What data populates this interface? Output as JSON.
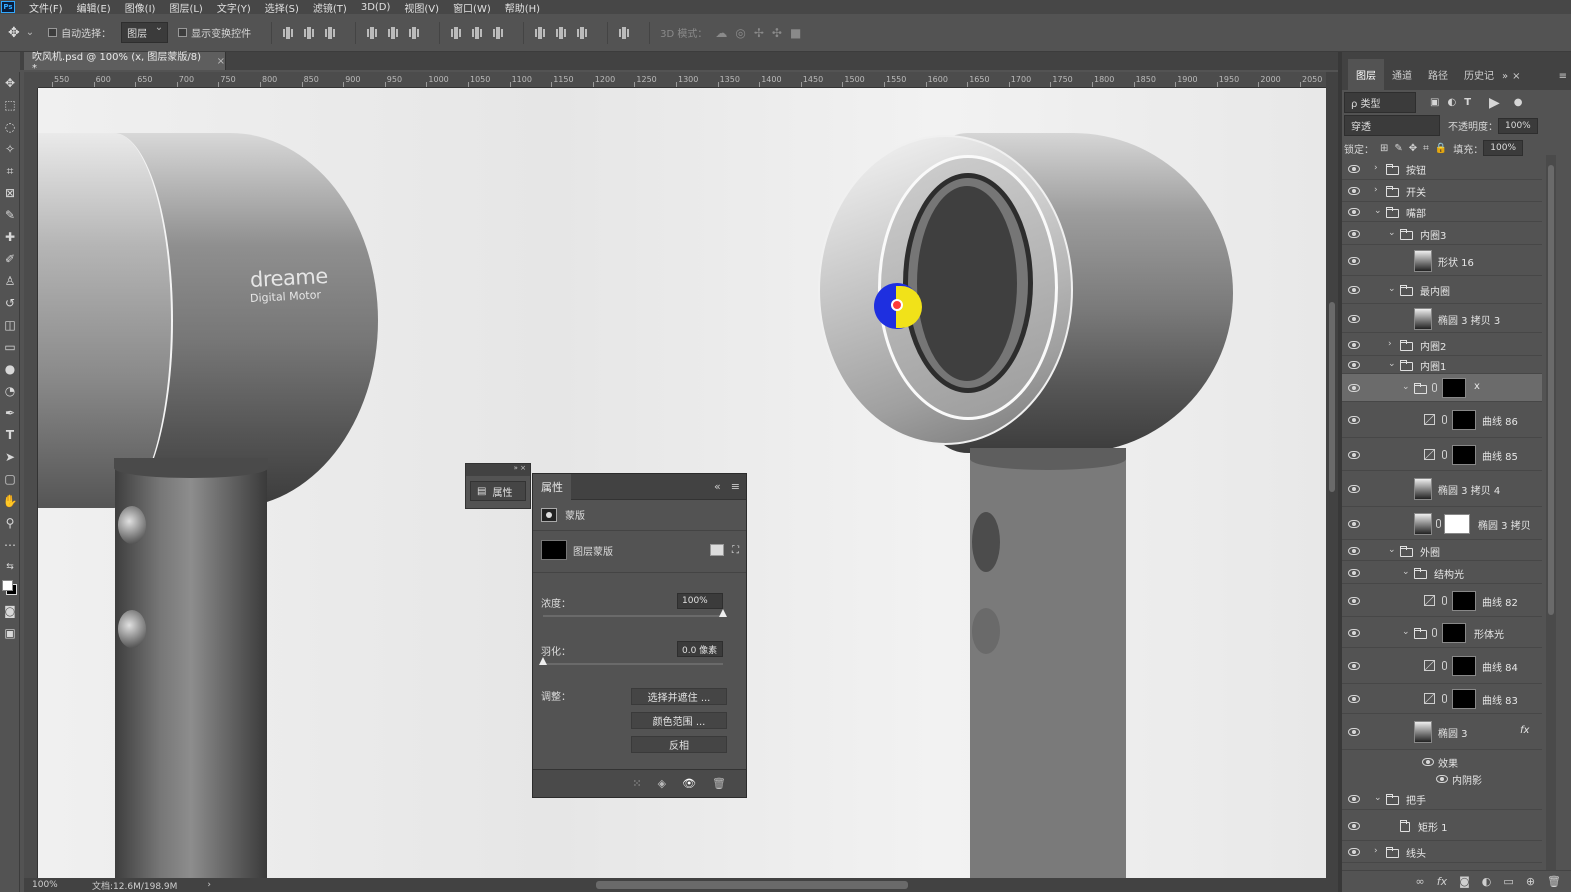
{
  "menu": {
    "app_icon": "Ps",
    "items": [
      "文件(F)",
      "编辑(E)",
      "图像(I)",
      "图层(L)",
      "文字(Y)",
      "选择(S)",
      "滤镜(T)",
      "3D(D)",
      "视图(V)",
      "窗口(W)",
      "帮助(H)"
    ]
  },
  "options": {
    "auto_select_label": "自动选择：",
    "auto_select_value": "图层",
    "show_transform_label": "显示变换控件",
    "mode_3d_label": "3D 模式："
  },
  "document": {
    "tab_title": "吹风机.psd @ 100% (x, 图层蒙版/8) *",
    "zoom": "100%",
    "doc_info": "文档:12.6M/198.9M"
  },
  "ruler": {
    "h_labels": [
      "550",
      "600",
      "650",
      "700",
      "750",
      "800",
      "850",
      "900",
      "950",
      "1000",
      "1050",
      "1100",
      "1150",
      "1200",
      "1250",
      "1300",
      "1350",
      "1400",
      "1450",
      "1500",
      "1550",
      "1600",
      "1650",
      "1700",
      "1750",
      "1800",
      "1850",
      "1900",
      "1950",
      "2000",
      "2050"
    ]
  },
  "canvas": {
    "brand_line1": "dreame",
    "brand_line2": "Digital Motor"
  },
  "mini_panel": {
    "button_label": "属性"
  },
  "properties": {
    "tab_label": "属性",
    "section_label": "蒙版",
    "mask_label": "图层蒙版",
    "density_label": "浓度：",
    "density_value": "100%",
    "density_fraction": 1.0,
    "feather_label": "羽化：",
    "feather_value": "0.0 像素",
    "feather_fraction": 0.0,
    "adjust_label": "调整：",
    "btn_select_mask": "选择并遮住 ...",
    "btn_color_range": "颜色范围 ...",
    "btn_invert": "反相"
  },
  "layers_panel": {
    "tabs": [
      "图层",
      "通道",
      "路径",
      "历史记"
    ],
    "filter_label": "ρ 类型",
    "blend_mode": "穿透",
    "opacity_label": "不透明度：",
    "opacity_value": "100%",
    "lock_label": "锁定：",
    "fill_label": "填充：",
    "fill_value": "100%",
    "layers": [
      {
        "name": "按钮",
        "type": "group",
        "indent": 0,
        "collapsed": true
      },
      {
        "name": "开关",
        "type": "group",
        "indent": 0,
        "collapsed": true
      },
      {
        "name": "嘴部",
        "type": "group",
        "indent": 0,
        "collapsed": false
      },
      {
        "name": "内圈3",
        "type": "group",
        "indent": 1,
        "collapsed": false
      },
      {
        "name": "形状 16",
        "type": "shape",
        "indent": 2
      },
      {
        "name": "最内圈",
        "type": "group",
        "indent": 1,
        "collapsed": false
      },
      {
        "name": "椭圆 3 拷贝 3",
        "type": "shape",
        "indent": 2
      },
      {
        "name": "内圈2",
        "type": "group",
        "indent": 1,
        "collapsed": true
      },
      {
        "name": "内圈1",
        "type": "group",
        "indent": 1,
        "collapsed": false
      },
      {
        "name": "x",
        "type": "masked-group",
        "indent": 2,
        "selected": true
      },
      {
        "name": "曲线 86",
        "type": "adjustment",
        "indent": 3
      },
      {
        "name": "曲线 85",
        "type": "adjustment",
        "indent": 3
      },
      {
        "name": "椭圆 3 拷贝 4",
        "type": "shape",
        "indent": 2
      },
      {
        "name": "椭圆 3 拷贝",
        "type": "shape-mask",
        "indent": 2
      },
      {
        "name": "外圈",
        "type": "group",
        "indent": 1,
        "collapsed": false
      },
      {
        "name": "结构光",
        "type": "group",
        "indent": 2,
        "collapsed": false
      },
      {
        "name": "曲线 82",
        "type": "adjustment",
        "indent": 3
      },
      {
        "name": "形体光",
        "type": "masked-group",
        "indent": 2
      },
      {
        "name": "曲线 84",
        "type": "adjustment",
        "indent": 3
      },
      {
        "name": "曲线 83",
        "type": "adjustment",
        "indent": 3
      },
      {
        "name": "椭圆 3",
        "type": "shape-fx",
        "indent": 2
      },
      {
        "name": "效果",
        "type": "effect",
        "indent": 3
      },
      {
        "name": "内阴影",
        "type": "effect-item",
        "indent": 3
      },
      {
        "name": "把手",
        "type": "group",
        "indent": 0,
        "collapsed": false
      },
      {
        "name": "矩形 1",
        "type": "shape-small",
        "indent": 1
      },
      {
        "name": "线头",
        "type": "group",
        "indent": 0,
        "collapsed": true
      }
    ]
  }
}
